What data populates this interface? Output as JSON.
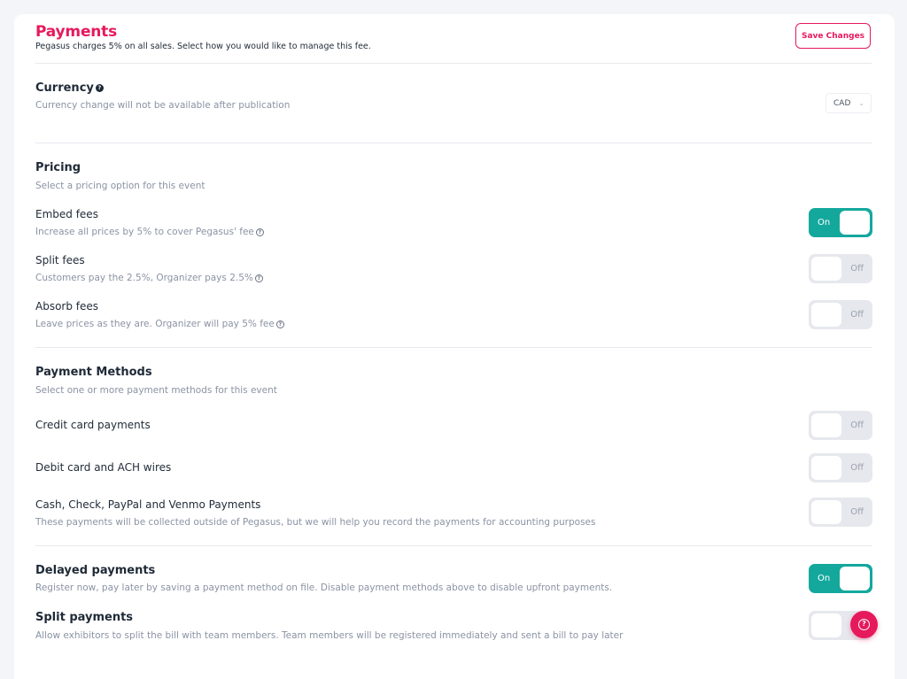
{
  "header": {
    "title": "Payments",
    "subtitle": "Pegasus charges 5% on all sales. Select how you would like to manage this fee.",
    "save_label": "Save Changes"
  },
  "currency": {
    "title": "Currency",
    "description": "Currency change will not be available after publication",
    "selected": "CAD",
    "help_icon": "?"
  },
  "pricing": {
    "title": "Pricing",
    "description": "Select a pricing option for this event",
    "options": [
      {
        "label": "Embed fees",
        "description": "Increase all prices by 5% to cover Pegasus' fee",
        "state": "On"
      },
      {
        "label": "Split fees",
        "description": "Customers pay the 2.5%, Organizer pays 2.5%",
        "state": "Off"
      },
      {
        "label": "Absorb fees",
        "description": "Leave prices as they are. Organizer will pay 5% fee",
        "state": "Off"
      }
    ]
  },
  "payment_methods": {
    "title": "Payment Methods",
    "description": "Select one or more payment methods for this event",
    "options": [
      {
        "label": "Credit card payments",
        "state": "Off"
      },
      {
        "label": "Debit card and ACH wires",
        "state": "Off"
      },
      {
        "label": "Cash, Check, PayPal and Venmo Payments",
        "description": "These payments will be collected outside of Pegasus, but we will help you record the payments for accounting purposes",
        "state": "Off"
      }
    ]
  },
  "delayed_payments": {
    "title": "Delayed payments",
    "description": "Register now, pay later by saving a payment method on file. Disable payment methods above to disable upfront payments.",
    "state": "On"
  },
  "split_payments": {
    "title": "Split payments",
    "description": "Allow exhibitors to split the bill with team members. Team members will be registered immediately and sent a bill to pay later",
    "state": "Off"
  },
  "help_fab": {
    "icon": "help-chat-icon",
    "glyph": "?"
  },
  "colors": {
    "accent": "#e6195c",
    "toggle_on": "#14a89d",
    "toggle_off": "#e6e8ed",
    "muted_text": "#8a93a3"
  }
}
